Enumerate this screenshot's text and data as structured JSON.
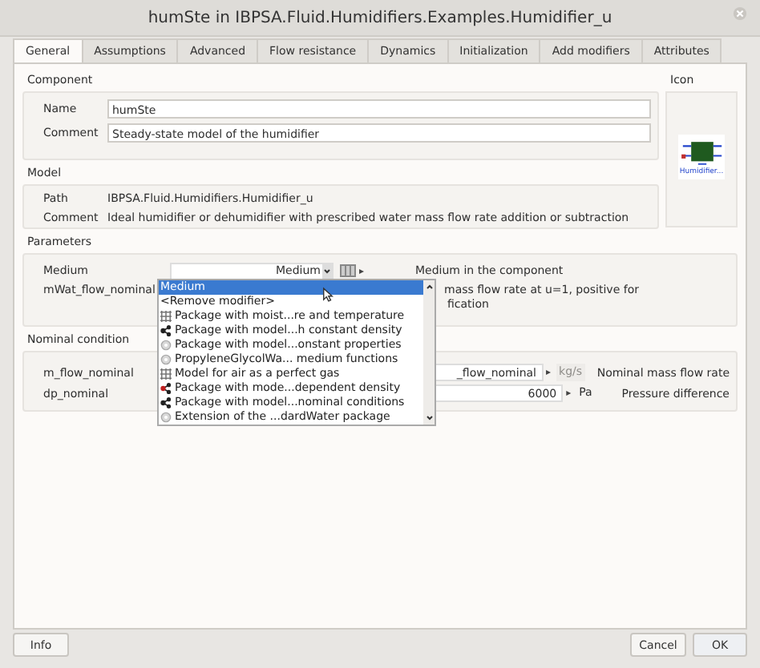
{
  "window": {
    "title": "humSte in IBPSA.Fluid.Humidifiers.Examples.Humidifier_u"
  },
  "tabs": [
    {
      "label": "General",
      "selected": true
    },
    {
      "label": "Assumptions",
      "selected": false
    },
    {
      "label": "Advanced",
      "selected": false
    },
    {
      "label": "Flow resistance",
      "selected": false
    },
    {
      "label": "Dynamics",
      "selected": false
    },
    {
      "label": "Initialization",
      "selected": false
    },
    {
      "label": "Add modifiers",
      "selected": false
    },
    {
      "label": "Attributes",
      "selected": false
    }
  ],
  "component": {
    "heading": "Component",
    "fields": [
      {
        "label": "Name",
        "value": "humSte"
      },
      {
        "label": "Comment",
        "value": "Steady-state model of the humidifier"
      }
    ]
  },
  "icon": {
    "heading": "Icon",
    "caption": "Humidifier..."
  },
  "model": {
    "heading": "Model",
    "rows": [
      {
        "label": "Path",
        "value": "IBPSA.Fluid.Humidifiers.Humidifier_u"
      },
      {
        "label": "Comment",
        "value": "Ideal humidifier or dehumidifier with prescribed water mass flow rate addition or subtraction"
      }
    ]
  },
  "parameters": {
    "heading": "Parameters",
    "medium": {
      "label": "Medium",
      "value": "Medium",
      "arrow": "▸",
      "description": "Medium in the component"
    },
    "mwat": {
      "label": "mWat_flow_nominal",
      "description_lines": [
        "mass flow rate at u=1, positive for",
        "fication"
      ]
    }
  },
  "nominal": {
    "heading": "Nominal condition",
    "rows": [
      {
        "label": "m_flow_nominal",
        "value": "_flow_nominal",
        "arrow": "▸",
        "unit": "kg/s",
        "unit_disabled": true,
        "description": "Nominal mass flow rate"
      },
      {
        "label": "dp_nominal",
        "value": "6000",
        "arrow": "▸",
        "unit": "Pa",
        "unit_disabled": false,
        "description": "Pressure difference"
      }
    ]
  },
  "dropdown": {
    "items": [
      {
        "label": "Medium",
        "kind": "text",
        "selected": true
      },
      {
        "label": "<Remove modifier>",
        "kind": "text",
        "selected": false
      },
      {
        "label": "Package with moist...re and temperature",
        "kind": "grid",
        "selected": false
      },
      {
        "label": "Package with model...h constant density",
        "kind": "graph",
        "selected": false
      },
      {
        "label": "Package with model...onstant properties",
        "kind": "gear",
        "selected": false
      },
      {
        "label": "PropyleneGlycolWa... medium functions",
        "kind": "gear",
        "selected": false
      },
      {
        "label": "Model for air as a perfect gas",
        "kind": "grid",
        "selected": false
      },
      {
        "label": "Package with mode...dependent density",
        "kind": "graph-red",
        "selected": false
      },
      {
        "label": "Package with model...nominal conditions",
        "kind": "graph",
        "selected": false
      },
      {
        "label": "Extension of the ...dardWater package",
        "kind": "gear",
        "selected": false
      }
    ]
  },
  "buttons": {
    "info": "Info",
    "cancel": "Cancel",
    "ok": "OK"
  }
}
